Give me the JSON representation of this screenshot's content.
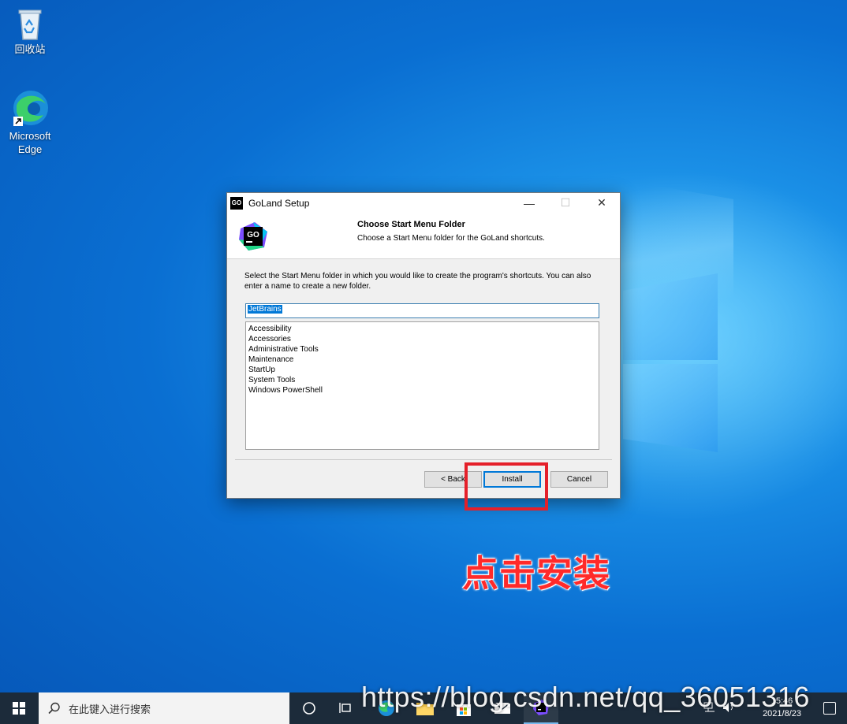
{
  "desktop": {
    "icons": [
      {
        "label": "回收站"
      },
      {
        "label": "Microsoft\nEdge"
      }
    ]
  },
  "dialog": {
    "title": "GoLand Setup",
    "logo_text": "GO",
    "header_title": "Choose Start Menu Folder",
    "header_subtitle": "Choose a Start Menu folder for the GoLand shortcuts.",
    "instructions": "Select the Start Menu folder in which you would like to create the program's shortcuts. You can also enter a name to create a new folder.",
    "folder_input_value": "JetBrains",
    "folders": [
      "Accessibility",
      "Accessories",
      "Administrative Tools",
      "Maintenance",
      "StartUp",
      "System Tools",
      "Windows PowerShell"
    ],
    "buttons": {
      "back": "< Back",
      "install": "Install",
      "cancel": "Cancel"
    }
  },
  "annotation": {
    "text": "点击安装",
    "color": "#e5202a"
  },
  "taskbar": {
    "search_placeholder": "在此键入进行搜索",
    "time": "15:46",
    "date": "2021/8/23"
  },
  "watermark": "https://blog.csdn.net/qq_36051316",
  "colors": {
    "accent": "#0078d7",
    "taskbar": "#1c2b3a",
    "highlight_red": "#e5202a"
  }
}
